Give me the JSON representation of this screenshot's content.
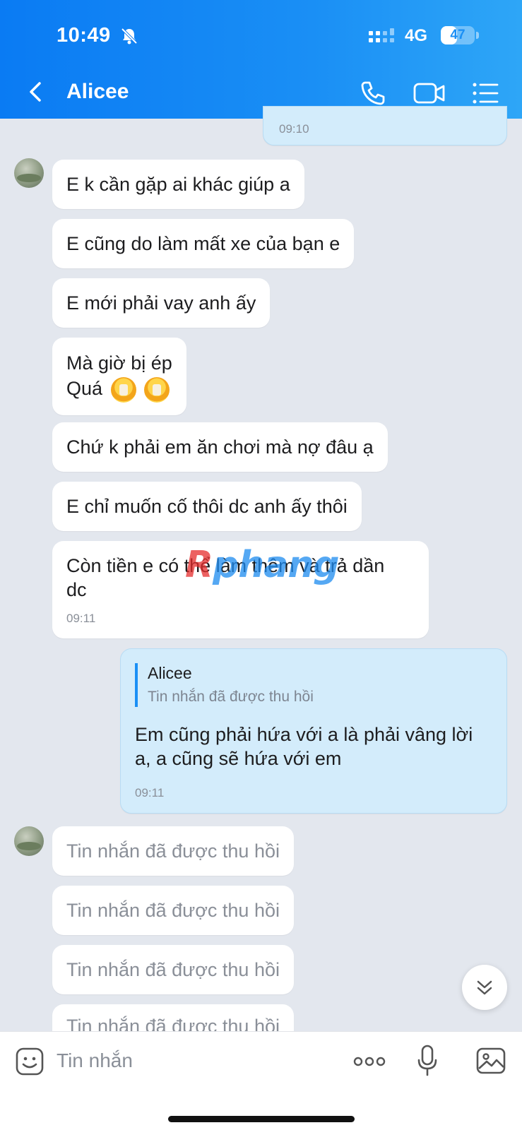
{
  "status_bar": {
    "time": "10:49",
    "network": "4G",
    "battery": "47",
    "battery_level": 0.47
  },
  "header": {
    "title": "Alicee"
  },
  "top_timestamp": "09:10",
  "messages_block1": [
    "E k cần gặp ai khác giúp a",
    "E cũng do làm mất xe của bạn e",
    "E mới phải vay anh ấy",
    "Mà giờ bị ép",
    "Quá",
    "Chứ k phải em ăn chơi mà nợ đâu ạ",
    "E chỉ muốn cố thôi dc anh ấy thôi",
    "Còn tiền e có thể làm thêm và trả dần",
    "dc"
  ],
  "block1_timestamp": "09:11",
  "reply": {
    "quote_name": "Alicee",
    "quote_text": "Tin nhắn đã được thu hồi",
    "line1": "Em cũng phải hứa với a là phải vâng lời",
    "line2": "a, a cũng sẽ hứa với em",
    "timestamp": "09:11"
  },
  "recalled_messages": [
    "Tin nhắn đã được thu hồi",
    "Tin nhắn đã được thu hồi",
    "Tin nhắn đã được thu hồi",
    "Tin nhắn đã được thu hồi"
  ],
  "watermark": {
    "first": "R",
    "rest": "phang"
  },
  "input": {
    "placeholder": "Tin nhắn"
  },
  "colors": {
    "header": "#0a7bf3",
    "my_bubble": "#d3ecfb",
    "background": "#e3e7ee"
  }
}
